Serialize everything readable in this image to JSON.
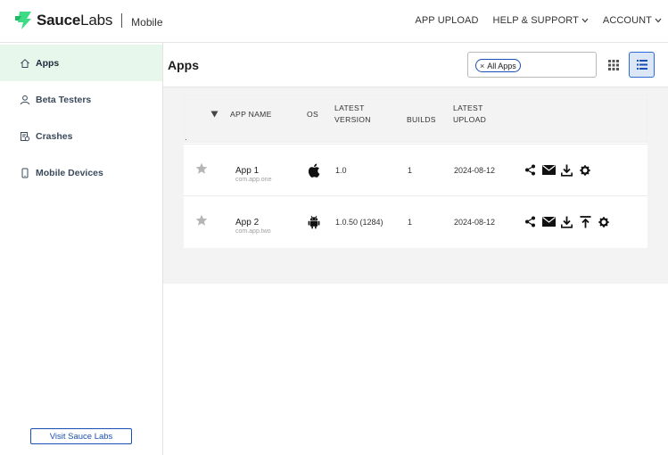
{
  "header": {
    "brand_bold": "Sauce",
    "brand_light": "Labs",
    "product": "Mobile",
    "nav": [
      {
        "label": "APP UPLOAD",
        "dropdown": false
      },
      {
        "label": "HELP & SUPPORT",
        "dropdown": true
      },
      {
        "label": "ACCOUNT",
        "dropdown": true
      }
    ]
  },
  "sidebar": {
    "items": [
      {
        "label": "Apps",
        "icon": "home-icon",
        "active": true
      },
      {
        "label": "Beta Testers",
        "icon": "user-icon",
        "active": false
      },
      {
        "label": "Crashes",
        "icon": "crash-icon",
        "active": false
      },
      {
        "label": "Mobile Devices",
        "icon": "phone-icon",
        "active": false
      }
    ],
    "visit_label": "Visit Sauce Labs"
  },
  "main": {
    "title": "Apps",
    "filter_chip": "All Apps",
    "filter_chip_remove": "×"
  },
  "table": {
    "headers": {
      "app_name": "APP NAME",
      "os": "OS",
      "latest_version_1": "LATEST",
      "latest_version_2": "VERSION",
      "builds": "BUILDS",
      "latest_upload_1": "LATEST",
      "latest_upload_2": "UPLOAD"
    },
    "rows": [
      {
        "name": "App 1",
        "package": "com.app.one",
        "os": "apple-icon",
        "version": "1.0",
        "builds": "1",
        "upload": "2024-08-12",
        "actions": [
          "share-icon",
          "email-icon",
          "download-icon",
          "settings-icon"
        ]
      },
      {
        "name": "App 2",
        "package": "com.app.two",
        "os": "android-icon",
        "version": "1.0.50 (1284)",
        "builds": "1",
        "upload": "2024-08-12",
        "actions": [
          "share-icon",
          "email-icon",
          "download-icon",
          "upload-icon",
          "settings-icon"
        ]
      }
    ]
  },
  "colors": {
    "accent_green": "#3ddc84",
    "active_bg": "#e8f7ec",
    "link_blue": "#1a4fb4"
  }
}
